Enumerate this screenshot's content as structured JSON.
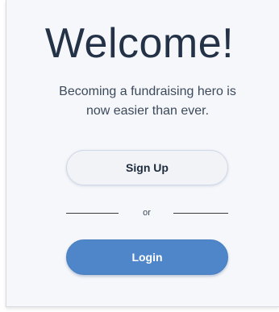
{
  "welcome": {
    "title": "Welcome!",
    "subtitle_line1": "Becoming a fundraising hero is",
    "subtitle_line2": "now easier than ever."
  },
  "actions": {
    "signup_label": "Sign Up",
    "divider_label": "or",
    "login_label": "Login"
  },
  "colors": {
    "title": "#233247",
    "login_button": "#4f86c9",
    "signup_button": "#f1f3f7",
    "background": "#f6f7fa"
  }
}
